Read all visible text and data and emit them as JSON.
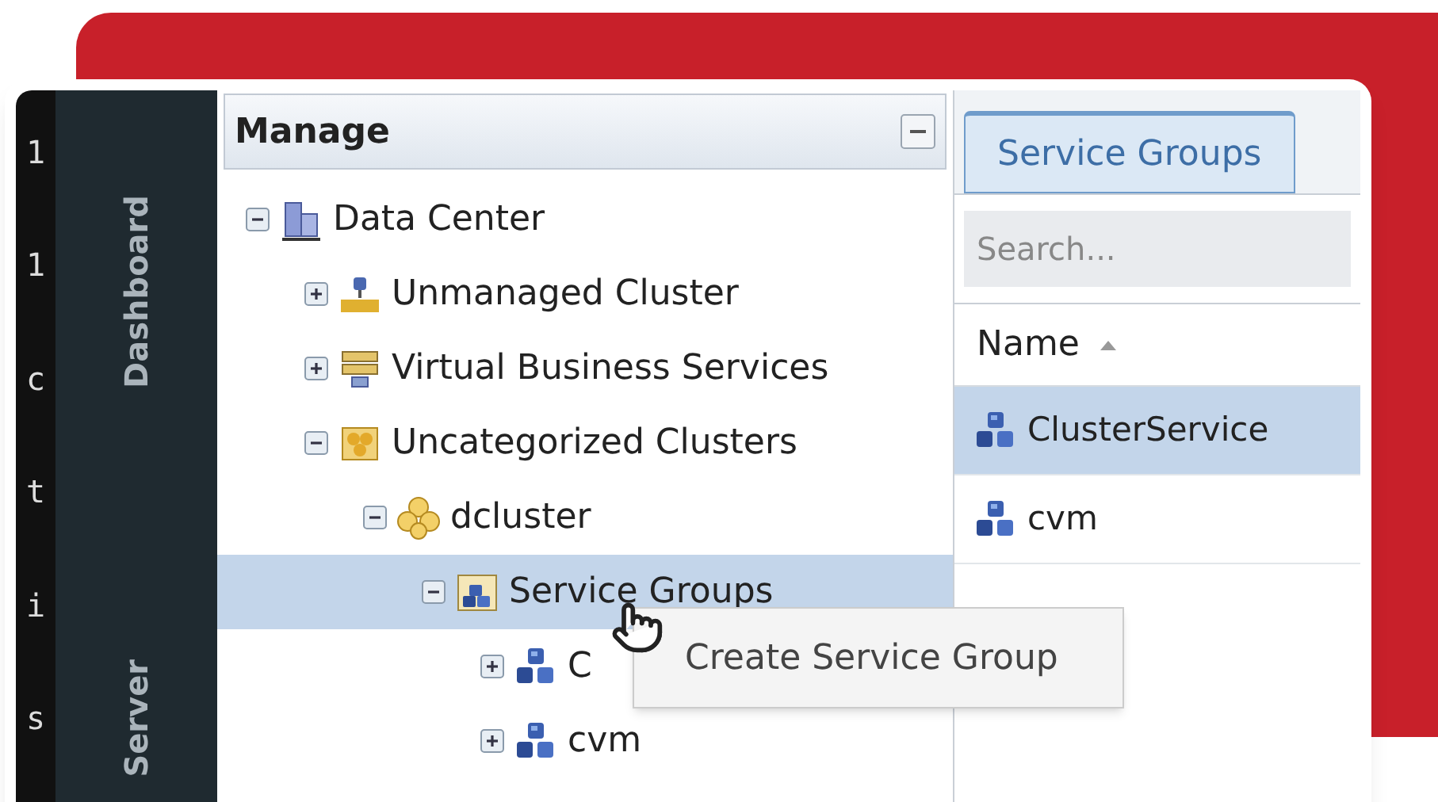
{
  "terminal": {
    "lines": [
      "1",
      "1",
      "c",
      "t",
      "i",
      "s"
    ]
  },
  "nav": {
    "items": [
      {
        "label": "Dashboard",
        "selected": false
      },
      {
        "label": "Server",
        "selected": false
      }
    ]
  },
  "manage": {
    "title": "Manage",
    "tree": [
      {
        "label": "Data Center",
        "kind": "datacenter",
        "expanded": true,
        "selected": false,
        "children": [
          {
            "label": "Unmanaged Cluster",
            "kind": "unmanaged",
            "expanded": false,
            "selected": false
          },
          {
            "label": "Virtual Business Services",
            "kind": "vbs",
            "expanded": false,
            "selected": false
          },
          {
            "label": "Uncategorized Clusters",
            "kind": "clusters",
            "expanded": true,
            "selected": false,
            "children": [
              {
                "label": "dcluster",
                "kind": "cluster",
                "expanded": true,
                "selected": false,
                "children": [
                  {
                    "label": "Service Groups",
                    "kind": "folder",
                    "expanded": true,
                    "selected": true,
                    "children": [
                      {
                        "label": "C",
                        "kind": "servicegroup",
                        "expanded": false,
                        "selected": false
                      },
                      {
                        "label": "cvm",
                        "kind": "servicegroup",
                        "expanded": false,
                        "selected": false
                      }
                    ]
                  }
                ]
              }
            ]
          }
        ]
      }
    ],
    "tooltip": "Create Service Group"
  },
  "service_panel": {
    "tabs": [
      {
        "label": "Service Groups",
        "selected": true
      }
    ],
    "search": {
      "placeholder": "Search..."
    },
    "columns": [
      {
        "label": "Name",
        "sorted_ascending": true
      }
    ],
    "rows": [
      {
        "name": "ClusterService",
        "selected": true
      },
      {
        "name": "cvm",
        "selected": false
      }
    ]
  }
}
